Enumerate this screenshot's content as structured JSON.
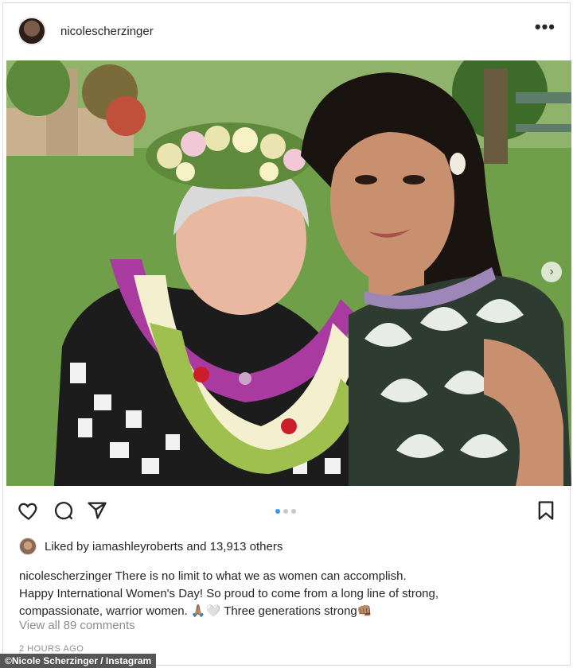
{
  "post": {
    "username": "nicolescherzinger",
    "more_label": "•••",
    "carousel_next": "›",
    "likes_text": "Liked by iamashleyroberts and 13,913 others",
    "caption_user": "nicolescherzinger",
    "caption_line1": "There is no limit to what we as women can accomplish.",
    "caption_line2": "Happy International Women's Day! So proud to come from a long line of strong,",
    "caption_line3": "compassionate, warrior women. 🙏🏽🤍 Three generations strong👊🏽",
    "view_comments": "View all 89 comments",
    "timestamp": "2 HOURS AGO"
  },
  "carousel": {
    "count": 3,
    "active_index": 0
  },
  "credit": "©Nicole Scherzinger / Instagram",
  "colors": {
    "accent": "#3897f0",
    "text": "#262626",
    "muted": "#8e8e8e"
  }
}
